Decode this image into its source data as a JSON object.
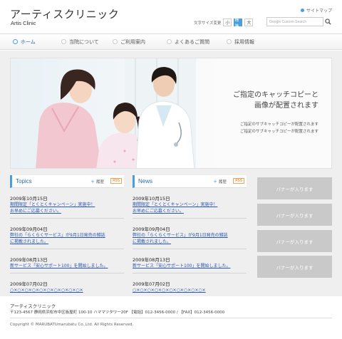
{
  "header": {
    "logo_ja": "アーティスクリニック",
    "logo_en": "Artis Clinic",
    "sitemap": "サイトマップ",
    "fontsize_label": "文字サイズ変更",
    "fontsize_options": [
      "小",
      "標準",
      "大"
    ],
    "search_placeholder": "Google Custom Search"
  },
  "nav": {
    "items": [
      "ホーム",
      "当院について",
      "ご利用案内",
      "よくあるご質問",
      "採用情報"
    ]
  },
  "hero": {
    "catch_line1": "ご指定のキャッチコピーと",
    "catch_line2": "画像が配置されます",
    "sub_line1": "ご指定のサブキャッチコピーが配置されます",
    "sub_line2": "ご指定のサブキャッチコピーが配置されます"
  },
  "topics": {
    "title": "Topics",
    "history": "履歴",
    "rss": "RSS",
    "items": [
      {
        "date": "2009年10月15日",
        "lines": [
          "期間限定「とくとくキャンペーン」実施中！",
          "お早めにご応募ください。"
        ]
      },
      {
        "date": "2009年09月04日",
        "lines": [
          "弊社の「らくらくサービス」が9月1日発売の雑誌",
          "に掲載されました。"
        ]
      },
      {
        "date": "2009年08月13日",
        "lines": [
          "新サービス「安心サポート100」を開始しました。"
        ]
      },
      {
        "date": "2009年07月02日",
        "lines": [
          "○×○×○×○×○×○×○×○×○×○×"
        ]
      }
    ]
  },
  "news": {
    "title": "News",
    "history": "履歴",
    "rss": "RSS",
    "items": [
      {
        "date": "2009年10月15日",
        "lines": [
          "期間限定「とくとくキャンペーン」実施中！",
          "お早めにご応募ください。"
        ]
      },
      {
        "date": "2009年09月04日",
        "lines": [
          "弊社の「らくらくサービス」が9月1日発売の雑誌",
          "に掲載されました。"
        ]
      },
      {
        "date": "2009年08月13日",
        "lines": [
          "新サービス「安心サポート100」を開始しました。"
        ]
      },
      {
        "date": "2009年07月02日",
        "lines": [
          "○×○×○×○×○×○×○×○×○×○×"
        ]
      }
    ]
  },
  "banners": [
    "バナーが入ります",
    "バナーが入ります",
    "バナーが入ります",
    "バナーが入ります"
  ],
  "footer": {
    "name": "アーティスクリニック",
    "address": "〒123-4567 静岡県浜松市中区板屋町 100-10 ハママツタワー20F 【電話】012-3456-0000 / 【FAX】012-3456-0000",
    "copyright": "Copyright © MARUBATUmarubatu Co.,Ltd. All Rights Reserved."
  },
  "colors": {
    "accent": "#4a9fd8",
    "link": "#2a56b4",
    "banner": "#c9c9c9",
    "band": "#efefef"
  }
}
